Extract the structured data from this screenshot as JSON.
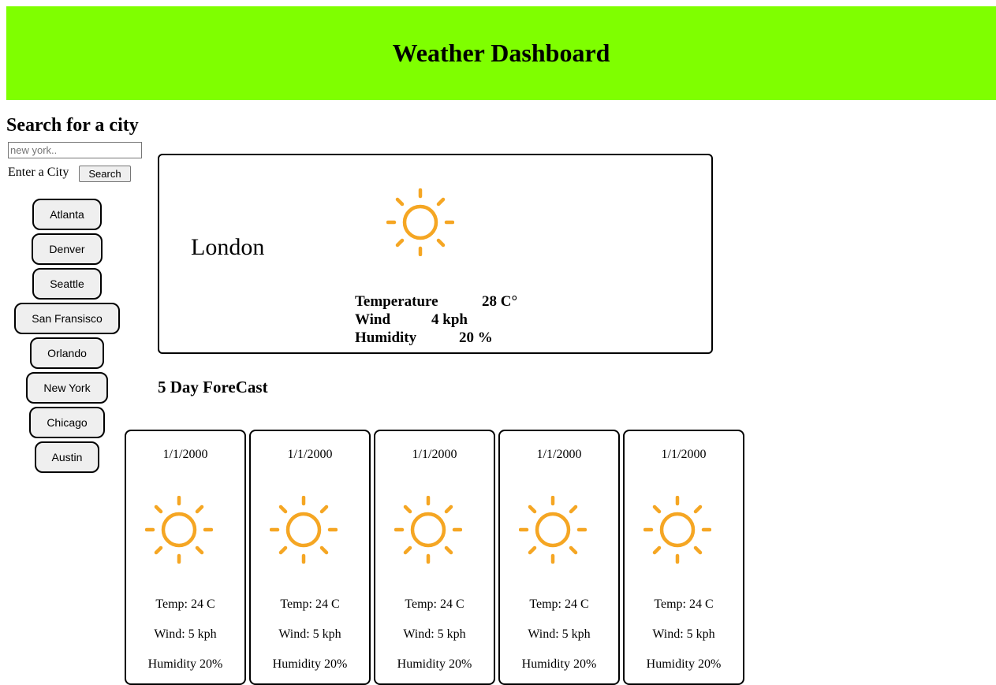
{
  "header": {
    "title": "Weather Dashboard",
    "background": "#7fff00"
  },
  "search": {
    "heading": "Search for a city",
    "placeholder": "new york..",
    "enter_label": "Enter a City",
    "button_label": "Search"
  },
  "cities": [
    "Atlanta",
    "Denver",
    "Seattle",
    "San Fransisco",
    "Orlando",
    "New York",
    "Chicago",
    "Austin"
  ],
  "current": {
    "city": "London",
    "icon": "sun-icon",
    "temperature_label": "Temperature",
    "temperature_value": "28 C°",
    "wind_label": "Wind",
    "wind_value": "4 kph",
    "humidity_label": "Humidity",
    "humidity_value": "20 %"
  },
  "forecast": {
    "heading": "5 Day ForeCast",
    "days": [
      {
        "date": "1/1/2000",
        "icon": "sun-icon",
        "temp": "Temp: 24 C",
        "wind": "Wind: 5 kph",
        "humidity": "Humidity 20%"
      },
      {
        "date": "1/1/2000",
        "icon": "sun-icon",
        "temp": "Temp: 24 C",
        "wind": "Wind: 5 kph",
        "humidity": "Humidity 20%"
      },
      {
        "date": "1/1/2000",
        "icon": "sun-icon",
        "temp": "Temp: 24 C",
        "wind": "Wind: 5 kph",
        "humidity": "Humidity 20%"
      },
      {
        "date": "1/1/2000",
        "icon": "sun-icon",
        "temp": "Temp: 24 C",
        "wind": "Wind: 5 kph",
        "humidity": "Humidity 20%"
      },
      {
        "date": "1/1/2000",
        "icon": "sun-icon",
        "temp": "Temp: 24 C",
        "wind": "Wind: 5 kph",
        "humidity": "Humidity 20%"
      }
    ]
  },
  "colors": {
    "sun": "#f5a623"
  }
}
